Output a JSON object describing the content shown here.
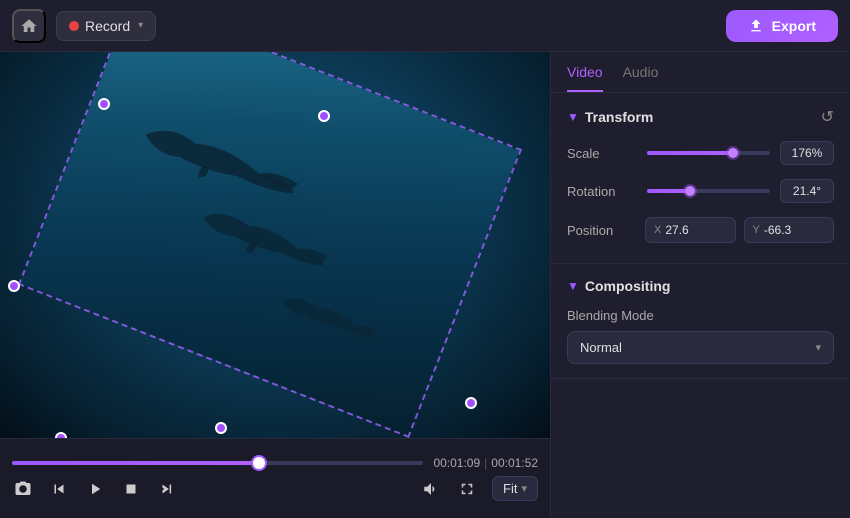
{
  "header": {
    "home_label": "home",
    "record_label": "Record",
    "export_label": "Export"
  },
  "tabs": {
    "video_label": "Video",
    "audio_label": "Audio",
    "active": "video"
  },
  "transform": {
    "section_label": "Transform",
    "scale_label": "Scale",
    "scale_value": "176%",
    "scale_fill_pct": 70,
    "scale_thumb_pct": 70,
    "rotation_label": "Rotation",
    "rotation_value": "21.4°",
    "rotation_fill_pct": 35,
    "rotation_thumb_pct": 35,
    "position_label": "Position",
    "pos_x_label": "X",
    "pos_x_value": "27.6",
    "pos_y_label": "Y",
    "pos_y_value": "-66.3"
  },
  "compositing": {
    "section_label": "Compositing",
    "blend_mode_label": "Blending Mode",
    "blend_mode_value": "Normal"
  },
  "controls": {
    "current_time": "00:01:09",
    "total_time": "00:01:52",
    "fit_label": "Fit"
  }
}
